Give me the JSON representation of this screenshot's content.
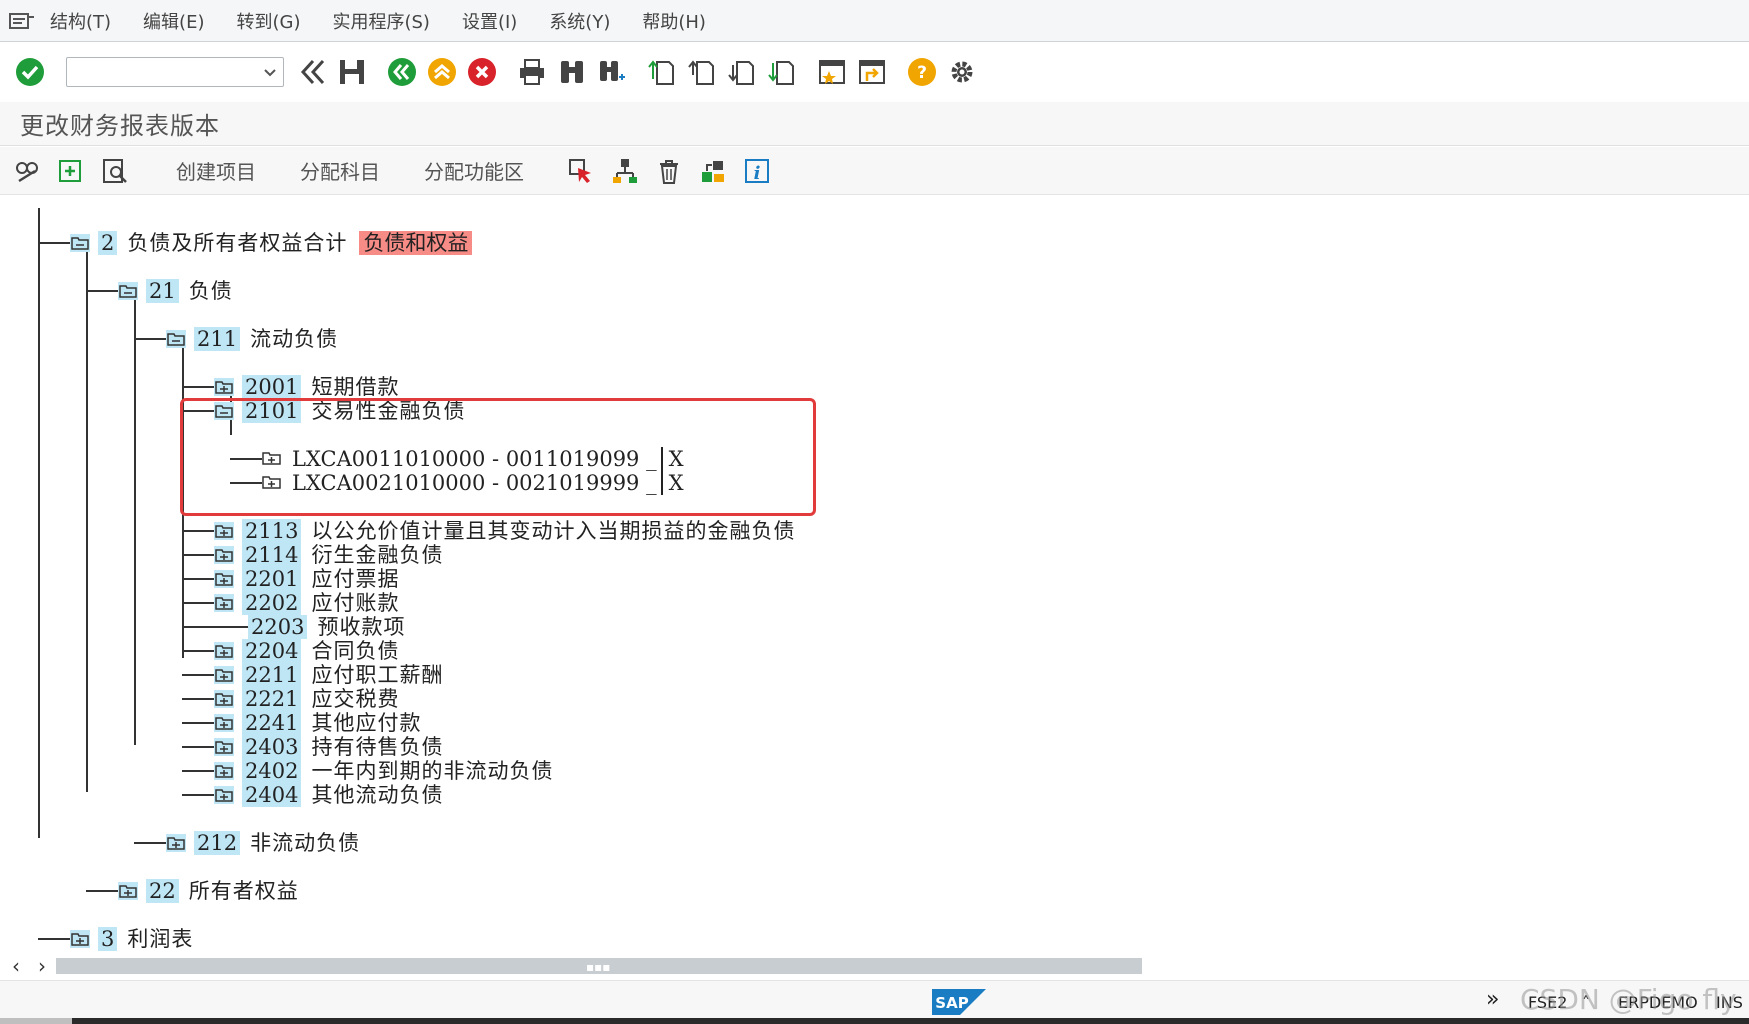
{
  "menu": {
    "items": [
      "结构(T)",
      "编辑(E)",
      "转到(G)",
      "实用程序(S)",
      "设置(I)",
      "系统(Y)",
      "帮助(H)"
    ]
  },
  "toolbar": {
    "command_value": ""
  },
  "page_title": "更改财务报表版本",
  "app_toolbar": {
    "create_item": "创建项目",
    "assign_accounts": "分配科目",
    "assign_functional_area": "分配功能区"
  },
  "tree": {
    "n2": {
      "code": "2",
      "label": "负债及所有者权益合计",
      "tag": "负债和权益"
    },
    "n21": {
      "code": "21",
      "label": "负债"
    },
    "n211": {
      "code": "211",
      "label": "流动负债"
    },
    "n2001": {
      "code": "2001",
      "label": "短期借款"
    },
    "n2101": {
      "code": "2101",
      "label": "交易性金融负债"
    },
    "acct1": {
      "text": "LXCA0011010000 - 0011019099 _",
      "flag": "X"
    },
    "acct2": {
      "text": "LXCA0021010000 - 0021019999 _",
      "flag": "X"
    },
    "n2113": {
      "code": "2113",
      "label": "以公允价值计量且其变动计入当期损益的金融负债"
    },
    "n2114": {
      "code": "2114",
      "label": "衍生金融负债"
    },
    "n2201": {
      "code": "2201",
      "label": "应付票据"
    },
    "n2202": {
      "code": "2202",
      "label": "应付账款"
    },
    "n2203": {
      "code": "2203",
      "label": "预收款项"
    },
    "n2204": {
      "code": "2204",
      "label": "合同负债"
    },
    "n2211": {
      "code": "2211",
      "label": "应付职工薪酬"
    },
    "n2221": {
      "code": "2221",
      "label": "应交税费"
    },
    "n2241": {
      "code": "2241",
      "label": "其他应付款"
    },
    "n2403": {
      "code": "2403",
      "label": "持有待售负债"
    },
    "n2402": {
      "code": "2402",
      "label": "一年内到期的非流动负债"
    },
    "n2404": {
      "code": "2404",
      "label": "其他流动负债"
    },
    "n212": {
      "code": "212",
      "label": "非流动负债"
    },
    "n22": {
      "code": "22",
      "label": "所有者权益"
    },
    "n3": {
      "code": "3",
      "label": "利润表"
    }
  },
  "status": {
    "transaction": "FSE2",
    "system": "ERPDEMO",
    "mode": "INS",
    "watermark": "CSDN @Figo fly",
    "sap_logo_text": "SAP"
  },
  "colors": {
    "node_highlight": "#bfe6f5",
    "tag_red": "#f78b86",
    "highlight_box": "#e23b3b",
    "confirm_green": "#1f9d3a",
    "cancel_red": "#d9232b",
    "help_orange": "#f0a500"
  }
}
